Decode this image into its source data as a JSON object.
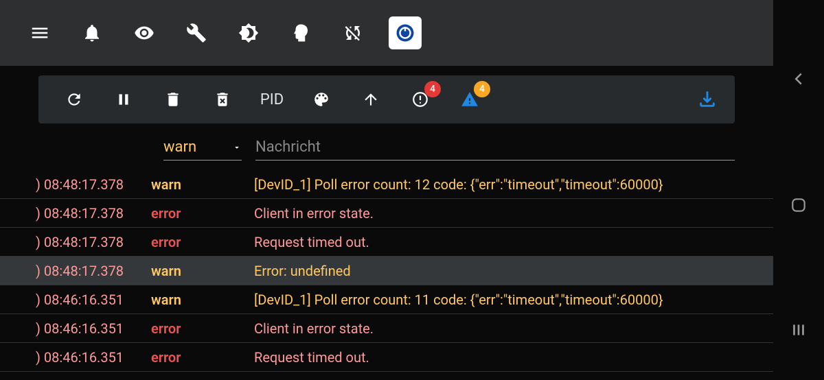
{
  "toolbar": {
    "pid_label": "PID"
  },
  "badges": {
    "error_count": "4",
    "warn_count": "4"
  },
  "filter": {
    "level": "warn",
    "message_placeholder": "Nachricht"
  },
  "logs": [
    {
      "time": ") 08:48:17.378",
      "level": "warn",
      "level_class": "warn",
      "msg_class": "warn",
      "message": "[DevID_1] Poll error count: 12 code: {\"err\":\"timeout\",\"timeout\":60000}",
      "highlighted": false
    },
    {
      "time": ") 08:48:17.378",
      "level": "error",
      "level_class": "error",
      "msg_class": "error",
      "message": "Client in error state.",
      "highlighted": false
    },
    {
      "time": ") 08:48:17.378",
      "level": "error",
      "level_class": "error",
      "msg_class": "error",
      "message": "Request timed out.",
      "highlighted": false
    },
    {
      "time": ") 08:48:17.378",
      "level": "warn",
      "level_class": "warn",
      "msg_class": "warn",
      "message": "Error: undefined",
      "highlighted": true
    },
    {
      "time": ") 08:46:16.351",
      "level": "warn",
      "level_class": "warn",
      "msg_class": "warn",
      "message": "[DevID_1] Poll error count: 11 code: {\"err\":\"timeout\",\"timeout\":60000}",
      "highlighted": false
    },
    {
      "time": ") 08:46:16.351",
      "level": "error",
      "level_class": "error",
      "msg_class": "error",
      "message": "Client in error state.",
      "highlighted": false
    },
    {
      "time": ") 08:46:16.351",
      "level": "error",
      "level_class": "error",
      "msg_class": "error",
      "message": "Request timed out.",
      "highlighted": false
    }
  ]
}
